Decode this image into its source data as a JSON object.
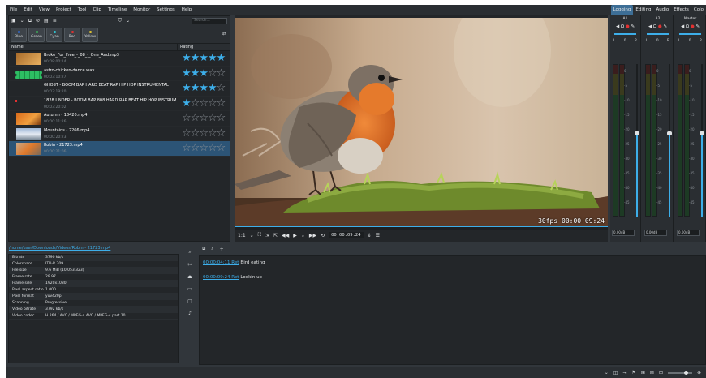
{
  "menubar": {
    "items": [
      "File",
      "Edit",
      "View",
      "Project",
      "Tool",
      "Clip",
      "Timeline",
      "Monitor",
      "Settings",
      "Help"
    ],
    "workspaces": [
      "Logging",
      "Editing",
      "Audio",
      "Effects",
      "Colo"
    ]
  },
  "bin": {
    "search_placeholder": "Search...",
    "tags": [
      {
        "label": "Blue",
        "color": "#2e6fe0"
      },
      {
        "label": "Green",
        "color": "#3cc05a"
      },
      {
        "label": "Cyan",
        "color": "#2fc7d5"
      },
      {
        "label": "Red",
        "color": "#e03131"
      },
      {
        "label": "Yellow",
        "color": "#e0c431"
      }
    ],
    "col_name": "Name",
    "col_rating": "Rating",
    "clips": [
      {
        "name": "Broke_For_Free_-_08_-_One_And.mp3",
        "duration": "00:08:00:14",
        "rating": 5
      },
      {
        "name": "astro-chicken-dance.wav",
        "duration": "00:03:10:27",
        "rating": 3
      },
      {
        "name": "GHOST - BOOM BAP HARD BEAT RAP HIP HOP INSTRUMENTAL",
        "duration": "00:03:19:20",
        "rating": 4
      },
      {
        "name": "1828 UNDER - BOOM BAP 808 HARD RAP BEAT HIP HOP INSTRUMENTAL",
        "duration": "00:03:20:02",
        "rating": 1
      },
      {
        "name": "Autumn - 18420.mp4",
        "duration": "00:00:11:26",
        "rating": 0
      },
      {
        "name": "Mountains - 2266.mp4",
        "duration": "00:00:20:23",
        "rating": 0
      },
      {
        "name": "Robin - 21723.mp4",
        "duration": "00:00:21:06",
        "rating": 0
      }
    ]
  },
  "monitor": {
    "overlay": "30fps 00:00:09:24",
    "zoom": "1:1",
    "timecode": "00:00:09:24"
  },
  "mixer": {
    "channels": [
      {
        "label": "A1",
        "db": "0.00dB",
        "level": 0.55
      },
      {
        "label": "A2",
        "db": "0.00dB",
        "level": 0.55
      },
      {
        "label": "Master",
        "db": "0.00dB",
        "level": 0.55
      }
    ],
    "db_ticks": [
      "0",
      "-5",
      "-10",
      "-15",
      "-20",
      "-25",
      "-30",
      "-35",
      "-40",
      "-45"
    ]
  },
  "properties": {
    "path": "/home/user/Downloads/Videos/Robin - 21723.mp4",
    "rows": [
      {
        "key": "Bitrate",
        "value": "3790 kb/s"
      },
      {
        "key": "Colorspace",
        "value": "ITU-R 709"
      },
      {
        "key": "File size",
        "value": "9.6 MiB (10,053,323)"
      },
      {
        "key": "Frame rate",
        "value": "29.97"
      },
      {
        "key": "Frame size",
        "value": "1920x1080"
      },
      {
        "key": "Pixel aspect ratio",
        "value": "1.000"
      },
      {
        "key": "Pixel format",
        "value": "yuv420p"
      },
      {
        "key": "Scanning",
        "value": "Progressive"
      },
      {
        "key": "Video bitrate",
        "value": "3792 kb/s"
      },
      {
        "key": "Video codec",
        "value": "H.264 / AVC / MPEG-4 AVC / MPEG-4 part 10"
      }
    ]
  },
  "notes": {
    "entries": [
      {
        "ts": "00:00:04:11 Ret",
        "text": "Bird eating"
      },
      {
        "ts": "00:00:09:24 Ret",
        "text": "Lookin up"
      }
    ]
  },
  "colors": {
    "accent": "#3daee9",
    "panel": "#31363b",
    "base": "#232629"
  }
}
